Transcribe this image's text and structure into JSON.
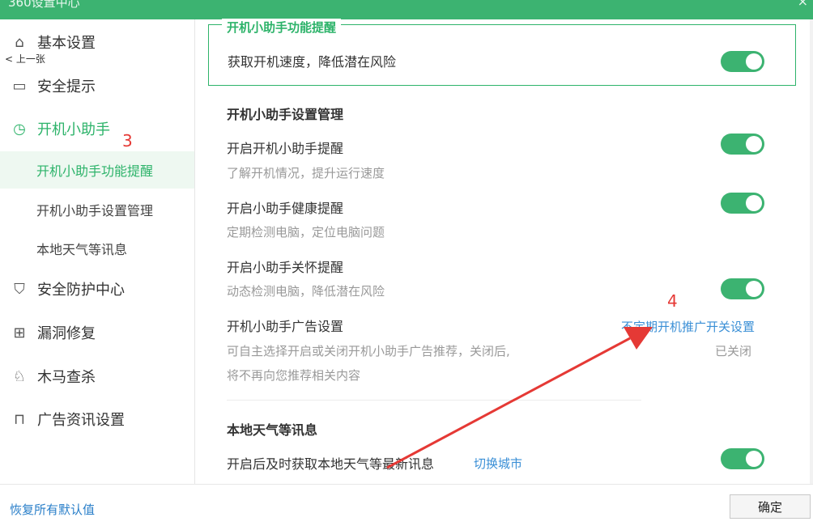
{
  "window": {
    "title": "360设置中心",
    "close_glyph": "×"
  },
  "sidebar": {
    "prev_label": "< 上一张",
    "items": [
      {
        "label": "基本设置",
        "icon": "home-icon"
      },
      {
        "label": "安全提示",
        "icon": "window-icon"
      },
      {
        "label": "开机小助手",
        "icon": "clock-icon"
      },
      {
        "label": "安全防护中心",
        "icon": "shield-icon"
      },
      {
        "label": "漏洞修复",
        "icon": "patch-icon"
      },
      {
        "label": "木马查杀",
        "icon": "horse-icon"
      },
      {
        "label": "广告资讯设置",
        "icon": "bookmark-icon"
      }
    ],
    "subitems": [
      {
        "label": "开机小助手功能提醒",
        "active": true
      },
      {
        "label": "开机小助手设置管理",
        "active": false
      },
      {
        "label": "本地天气等讯息",
        "active": false
      }
    ]
  },
  "content": {
    "feature": {
      "legend": "开机小助手功能提醒",
      "row_title": "获取开机速度，降低潜在风险",
      "toggle_on": true
    },
    "management": {
      "title": "开机小助手设置管理",
      "rows": [
        {
          "title": "开启开机小助手提醒",
          "desc": "了解开机情况，提升运行速度",
          "toggle_on": true
        },
        {
          "title": "开启小助手健康提醒",
          "desc": "定期检测电脑，定位电脑问题",
          "toggle_on": true
        },
        {
          "title": "开启小助手关怀提醒",
          "desc": "动态检测电脑，降低潜在风险",
          "toggle_on": true
        }
      ],
      "ad": {
        "title": "开机小助手广告设置",
        "desc_line1": "可自主选择开启或关闭开机小助手广告推荐，关闭后,",
        "desc_line2": "将不再向您推荐相关内容",
        "link": "不定期开机推广开关设置",
        "status": "已关闭"
      }
    },
    "weather": {
      "title": "本地天气等讯息",
      "row_title": "开启后及时获取本地天气等最新讯息",
      "link": "切换城市",
      "toggle_on": true
    }
  },
  "annotations": {
    "step3": "3",
    "step4": "4"
  },
  "footer": {
    "restore": "恢复所有默认值",
    "ok": "确定"
  },
  "colors": {
    "accent": "#3cb371",
    "link": "#3a8fd6",
    "annotation": "#e53935"
  }
}
